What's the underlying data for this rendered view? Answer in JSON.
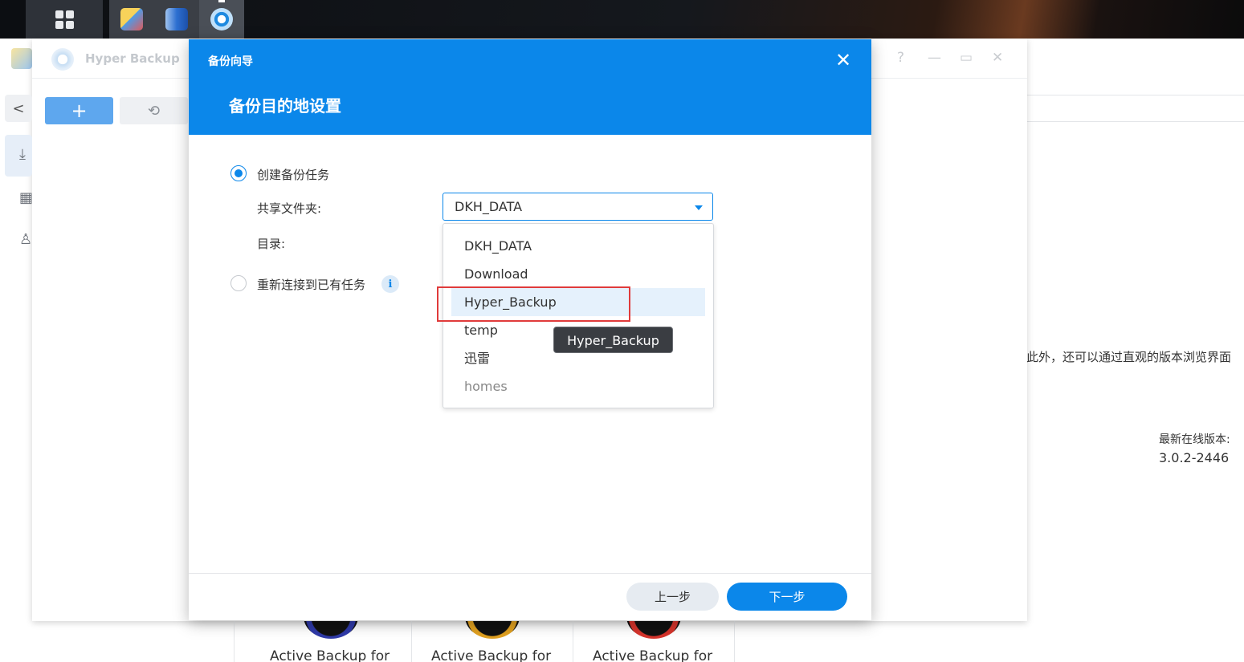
{
  "background": {
    "app_title": "Hyper Backup",
    "help_label": "?",
    "min_label": "—",
    "max_label": "▭",
    "close_label": "✕",
    "back_label": "<",
    "add_label": "+",
    "history_label": "⟲",
    "description_fragment": "此外，还可以通过直观的版本浏览界面",
    "latest_version_label": "最新在线版本:",
    "latest_version_value": "3.0.2-2446",
    "cards": [
      {
        "text": "Active Backup for",
        "ring_color": "#2f3aa8"
      },
      {
        "text": "Active Backup for",
        "ring_color": "#e0a020"
      },
      {
        "text": "Active Backup for",
        "ring_color": "#d6342c"
      }
    ]
  },
  "modal": {
    "app_label": "备份向导",
    "close_label": "✕",
    "title": "备份目的地设置",
    "option_create": "创建备份任务",
    "shared_folder_label": "共享文件夹:",
    "directory_label": "目录:",
    "option_reconnect": "重新连接到已有任务",
    "info_label": "i",
    "selected_folder": "DKH_DATA",
    "folder_options": [
      "DKH_DATA",
      "Download",
      "Hyper_Backup",
      "temp",
      "迅雷",
      "homes"
    ],
    "tooltip": "Hyper_Backup",
    "prev_label": "上一步",
    "next_label": "下一步"
  },
  "colors": {
    "accent": "#0b87ea",
    "highlight_row": "#e5f1fc",
    "annotation_red": "#e03b3b"
  }
}
